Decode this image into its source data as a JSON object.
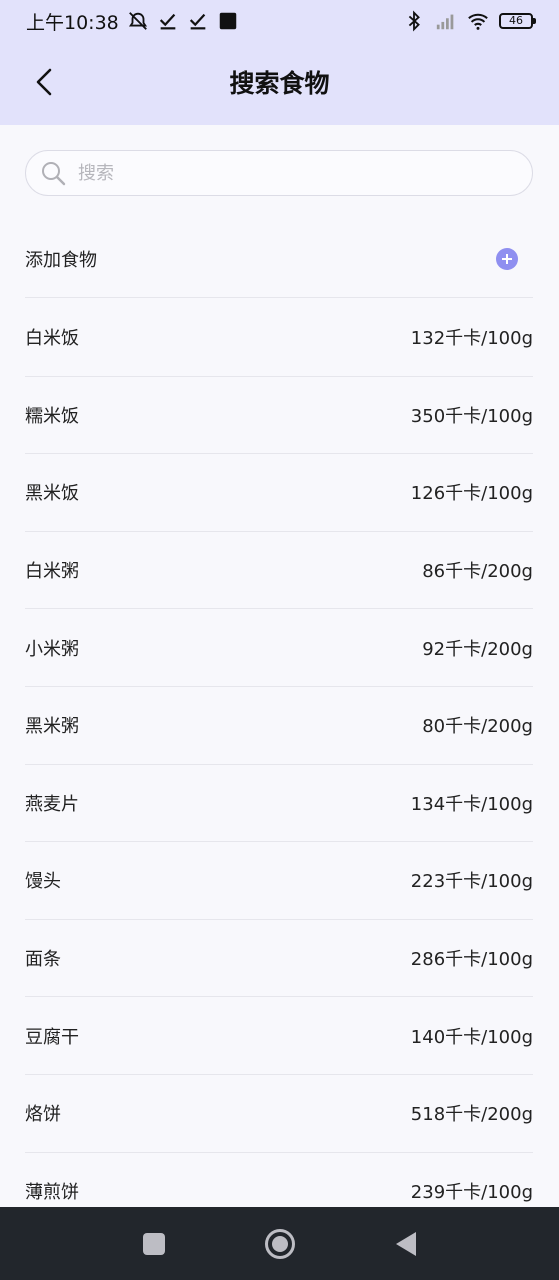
{
  "status_bar": {
    "time": "上午10:38",
    "battery": "46",
    "icons": [
      "alarm-off-icon",
      "check-icon",
      "check-icon",
      "square-app-icon",
      "bluetooth-icon",
      "signal-icon",
      "wifi-icon",
      "battery-icon"
    ]
  },
  "header": {
    "title": "搜索食物",
    "back_icon": "chevron-left-icon",
    "background": "#e2e2fb"
  },
  "search": {
    "placeholder": "搜索",
    "value": ""
  },
  "add_food": {
    "label": "添加食物",
    "icon": "plus-circle-icon",
    "accent": "#8f8ff0"
  },
  "foods": [
    {
      "name": "白米饭",
      "calories": "132千卡/100g"
    },
    {
      "name": "糯米饭",
      "calories": "350千卡/100g"
    },
    {
      "name": "黑米饭",
      "calories": "126千卡/100g"
    },
    {
      "name": "白米粥",
      "calories": "86千卡/200g"
    },
    {
      "name": "小米粥",
      "calories": "92千卡/200g"
    },
    {
      "name": "黑米粥",
      "calories": "80千卡/200g"
    },
    {
      "name": "燕麦片",
      "calories": "134千卡/100g"
    },
    {
      "name": "馒头",
      "calories": "223千卡/100g"
    },
    {
      "name": "面条",
      "calories": "286千卡/100g"
    },
    {
      "name": "豆腐干",
      "calories": "140千卡/100g"
    },
    {
      "name": "烙饼",
      "calories": "518千卡/200g"
    },
    {
      "name": "薄煎饼",
      "calories": "239千卡/100g"
    }
  ],
  "nav_bar": {
    "icons": [
      "recents-square-icon",
      "home-circle-icon",
      "back-triangle-icon"
    ]
  }
}
